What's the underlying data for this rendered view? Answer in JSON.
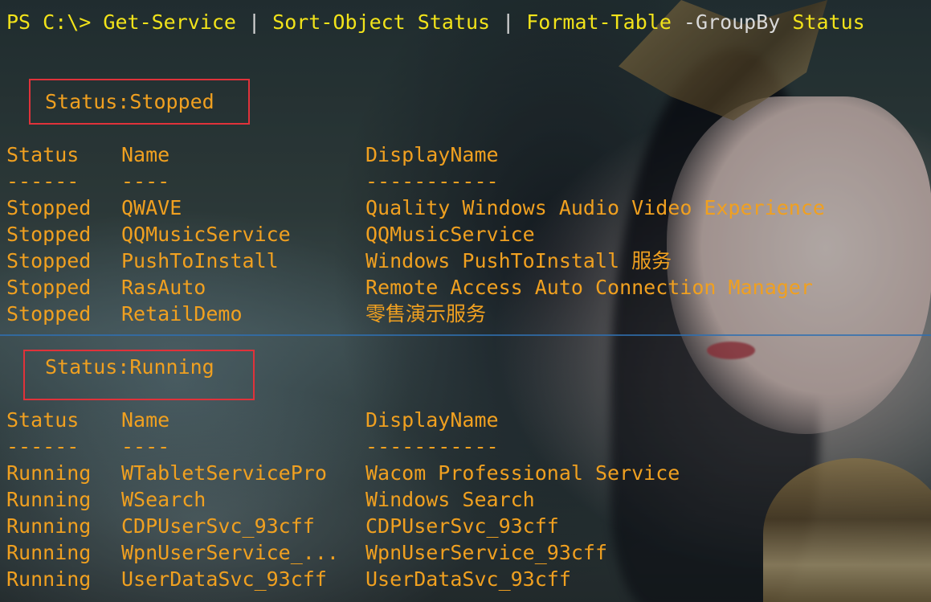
{
  "terminal": {
    "prompt": "PS C:\\> ",
    "command_parts": [
      "Get-Service",
      " | ",
      "Sort-Object",
      " Status",
      " | ",
      "Format-Table",
      " -GroupBy",
      " Status"
    ]
  },
  "groups": [
    {
      "title": "Status:Stopped",
      "headers": [
        "Status",
        "Name",
        "DisplayName"
      ],
      "underline": [
        "------",
        "----",
        "-----------"
      ],
      "rows": [
        [
          "Stopped",
          "QWAVE",
          "Quality Windows Audio Video Experience"
        ],
        [
          "Stopped",
          "QQMusicService",
          "QQMusicService"
        ],
        [
          "Stopped",
          "PushToInstall",
          "Windows PushToInstall 服务"
        ],
        [
          "Stopped",
          "RasAuto",
          "Remote Access Auto Connection Manager"
        ],
        [
          "Stopped",
          "RetailDemo",
          "零售演示服务"
        ]
      ]
    },
    {
      "title": "Status:Running",
      "headers": [
        "Status",
        "Name",
        "DisplayName"
      ],
      "underline": [
        "------",
        "----",
        "-----------"
      ],
      "rows": [
        [
          "Running",
          "WTabletServicePro",
          "Wacom Professional Service"
        ],
        [
          "Running",
          "WSearch",
          "Windows Search"
        ],
        [
          "Running",
          "CDPUserSvc_93cff",
          "CDPUserSvc_93cff"
        ],
        [
          "Running",
          "WpnUserService_...",
          "WpnUserService_93cff"
        ],
        [
          "Running",
          "UserDataSvc_93cff",
          "UserDataSvc_93cff"
        ]
      ]
    }
  ],
  "colors": {
    "output": "#f0a020",
    "command": "#f2e31a",
    "parameter": "#d8d8d8",
    "highlight_box": "#e0323a"
  }
}
